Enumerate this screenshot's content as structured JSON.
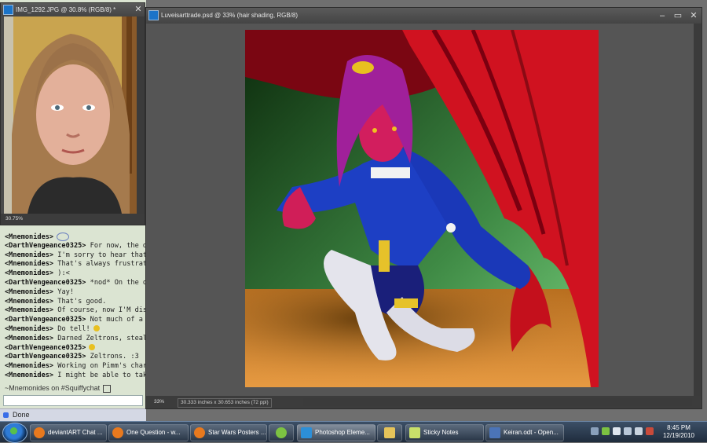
{
  "chat": {
    "lines": [
      {
        "nick": "<Mnemonides>",
        "msg": ""
      },
      {
        "nick": "<DarthVengeance0325>",
        "msg": " For now, the deta"
      },
      {
        "nick": "<Mnemonides>",
        "msg": " I'm sorry to hear that you"
      },
      {
        "nick": "<Mnemonides>",
        "msg": " That's always frustrating."
      },
      {
        "nick": "<Mnemonides>",
        "msg": " ):<"
      },
      {
        "nick": "<DarthVengeance0325>",
        "msg": " *nod* On the oth"
      },
      {
        "nick": "<Mnemonides>",
        "msg": " Yay!"
      },
      {
        "nick": "<Mnemonides>",
        "msg": " That's good."
      },
      {
        "nick": "<Mnemonides>",
        "msg": " Of course, now I'M distract"
      },
      {
        "nick": "<DarthVengeance0325>",
        "msg": " Not much of a plu"
      },
      {
        "nick": "<Mnemonides>",
        "msg": " Do tell!"
      },
      {
        "nick": "<Mnemonides>",
        "msg": " Darned Zeltrons, stealing m"
      },
      {
        "nick": "<DarthVengeance0325>",
        "msg": ""
      },
      {
        "nick": "<DarthVengeance0325>",
        "msg": " Zeltrons. :3"
      },
      {
        "nick": "<Mnemonides>",
        "msg": " Working on Pimm's charact"
      },
      {
        "nick": "<Mnemonides>",
        "msg": " I might be able to take a s"
      }
    ],
    "status": "~Mnemonides on #Squiffychat",
    "done_label": "Done"
  },
  "photo_window": {
    "title": "IMG_1292.JPG @ 30.8% (RGB/8) *",
    "zoom": "30.75%"
  },
  "art_window": {
    "title": "Luveisarttrade.psd @ 33% (hair shading, RGB/8)",
    "zoom": "33%",
    "doc_size": "30.333 inches x 30.653 inches (72 ppi)"
  },
  "taskbar": {
    "tasks": [
      {
        "label": "deviantART Chat ...",
        "icon": "firefox-icon",
        "color": "#e8791e"
      },
      {
        "label": "One Question - w...",
        "icon": "firefox-icon",
        "color": "#e8791e"
      },
      {
        "label": "Star Wars Posters ...",
        "icon": "firefox-icon",
        "color": "#e8791e"
      },
      {
        "label": "",
        "icon": "android-icon",
        "color": "#7cc242"
      },
      {
        "label": "Photoshop Eleme...",
        "icon": "photoshop-elements-icon",
        "color": "#2c8fd8"
      },
      {
        "label": "",
        "icon": "folder-icon",
        "color": "#e5c35a"
      },
      {
        "label": "Sticky Notes",
        "icon": "sticky-notes-icon",
        "color": "#c8e06a"
      },
      {
        "label": "Keiran.odt - Open...",
        "icon": "openoffice-icon",
        "color": "#4b74b8"
      }
    ],
    "time": "8:45 PM",
    "date": "12/19/2010"
  },
  "colors": {
    "ps_dark": "#4b4b4b",
    "chat_bg": "#dbe4d2",
    "taskbar": "#1f2c3d"
  }
}
